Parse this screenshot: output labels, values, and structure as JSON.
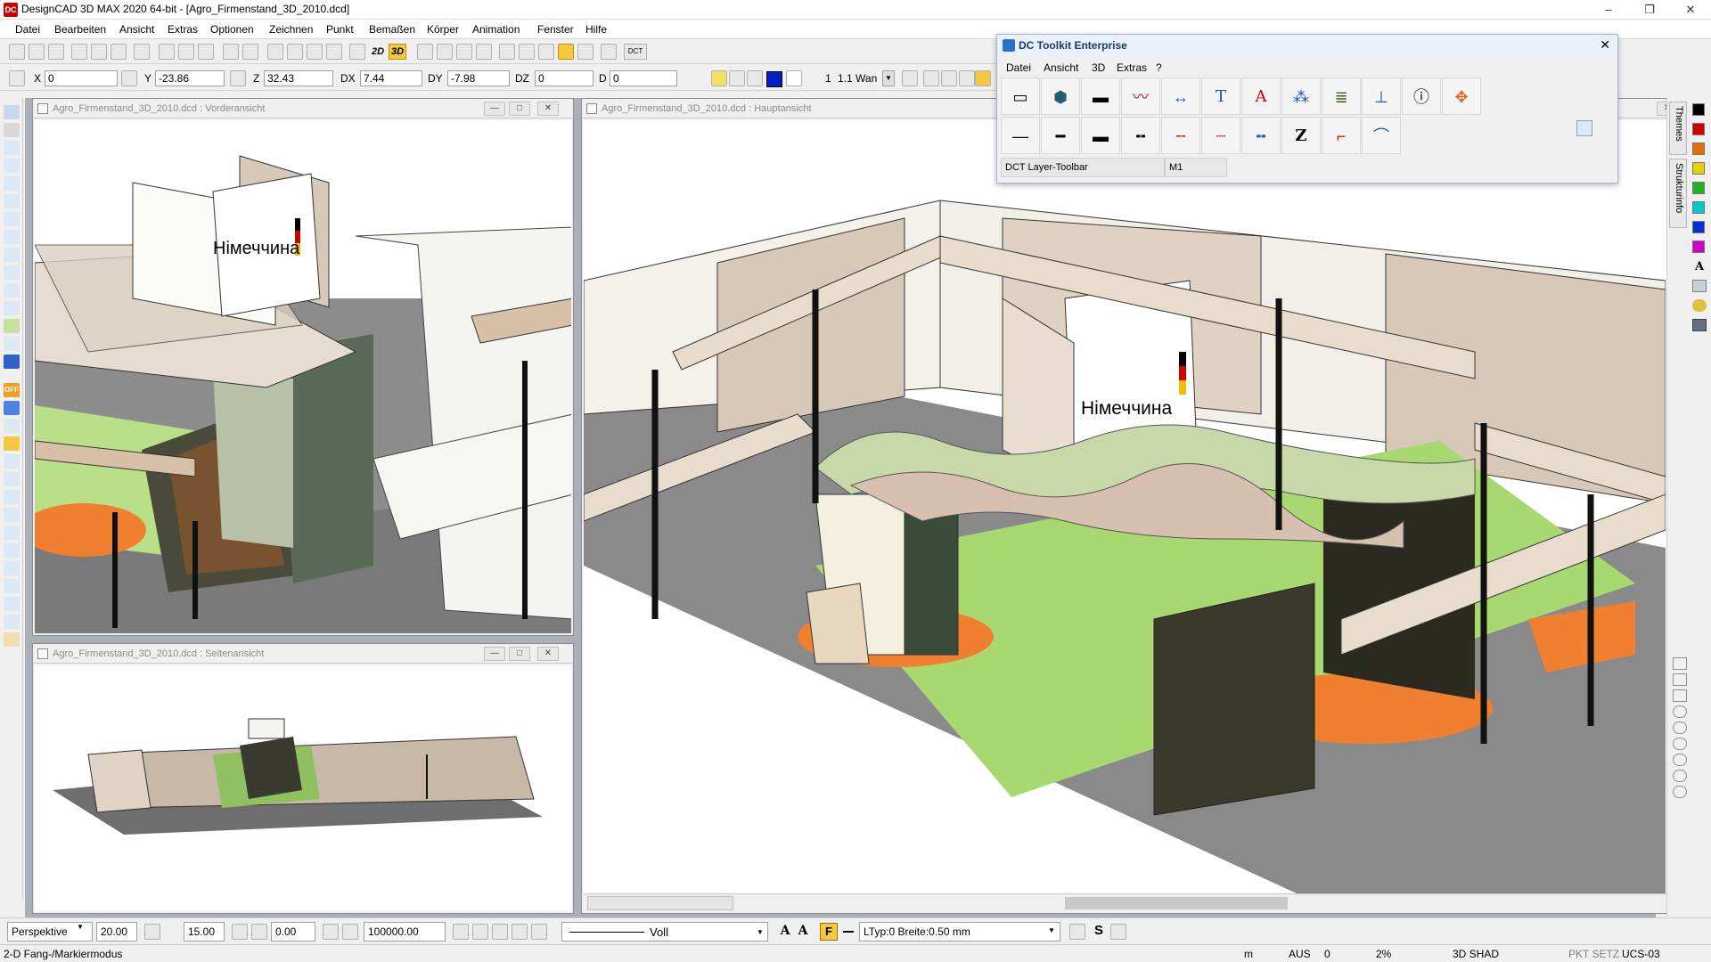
{
  "app": {
    "title": "DesignCAD 3D MAX 2020 64-bit - [Agro_Firmenstand_3D_2010.dcd]",
    "logo_text": "DC"
  },
  "window_controls": {
    "minimize": "–",
    "restore": "❐",
    "close": "✕"
  },
  "menu": [
    "Datei",
    "Bearbeiten",
    "Ansicht",
    "Extras",
    "Optionen",
    "Zeichnen",
    "Punkt",
    "Bemaßen",
    "Körper",
    "Animation",
    "Fenster",
    "Hilfe"
  ],
  "toolbar": {
    "mode_2d": "2D",
    "mode_3d": "3D",
    "dct_label": "DCT"
  },
  "coords": {
    "x_label": "X",
    "x_value": "0",
    "y_label": "Y",
    "y_value": "-23.86",
    "z_label": "Z",
    "z_value": "32.43",
    "dx_label": "DX",
    "dx_value": "7.44",
    "dy_label": "DY",
    "dy_value": "-7.98",
    "dz_label": "DZ",
    "dz_value": "0",
    "d_label": "D",
    "d_value": "0",
    "layer_value": "1",
    "layer_name": "1.1 Wan"
  },
  "left_tools": {
    "off_label": "OFF"
  },
  "views": {
    "front": {
      "title": "Agro_Firmenstand_3D_2010.dcd : Vorderansicht"
    },
    "side": {
      "title": "Agro_Firmenstand_3D_2010.dcd : Seitenansicht"
    },
    "main": {
      "title": "Agro_Firmenstand_3D_2010.dcd : Hauptansicht"
    }
  },
  "scene": {
    "sign_text": "Німеччина"
  },
  "toolkit": {
    "title": "DC Toolkit Enterprise",
    "menu": [
      "Datei",
      "Ansicht",
      "3D",
      "Extras",
      "?"
    ],
    "text_glyph": "T",
    "font_glyph": "A",
    "z_glyph": "Z",
    "layer_toolbar_label": "DCT Layer-Toolbar",
    "layer_value": "M1"
  },
  "right_panel": {
    "tab_themes": "Themes",
    "tab_struktur": "Strukturinfo",
    "colors": [
      "#000000",
      "#d40000",
      "#e07000",
      "#e8d000",
      "#20b020",
      "#00c8d0",
      "#0030d0",
      "#d000d0"
    ],
    "font_glyph": "A"
  },
  "bottom": {
    "projection": "Perspektive",
    "value1": "20.00",
    "value2": "15.00",
    "value3": "0.00",
    "value4": "100000.00",
    "linestyle": "Voll",
    "font_a1": "A",
    "font_a2": "A",
    "f_button": "F",
    "ltype": "LTyp:0  Breite:0.50 mm",
    "s_button": "S"
  },
  "status": {
    "mode": "2-D Fang-/Markiermodus",
    "unit": "m",
    "aus": "AUS",
    "zero": "0",
    "percent": "2%",
    "shading": "3D SHAD",
    "pkt": "PKT SETZ",
    "ucs": "UCS-03"
  }
}
